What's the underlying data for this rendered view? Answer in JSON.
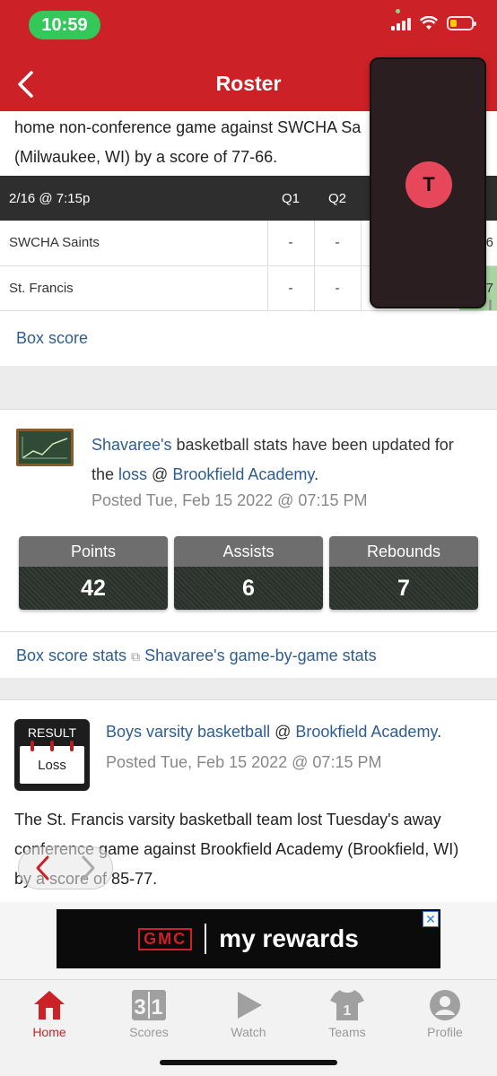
{
  "status": {
    "time": "10:59"
  },
  "nav": {
    "title": "Roster"
  },
  "story1": {
    "line1": "home non-conference game against SWCHA Sa",
    "line2": "(Milwaukee, WI) by a score of 77-66."
  },
  "scoreboard": {
    "header": [
      "2/16 @ 7:15p",
      "Q1",
      "Q2"
    ],
    "rows": [
      {
        "team": "SWCHA Saints",
        "q1": "-",
        "q2": "-",
        "final": "6"
      },
      {
        "team": "St. Francis",
        "q1": "-",
        "q2": "-",
        "final": "7"
      }
    ]
  },
  "box_score_link": "Box score",
  "stats_update": {
    "name": "Shavaree's",
    "text_mid": " basketball stats have been updated for",
    "text_the": "the ",
    "result_word": "loss",
    "at": " @ ",
    "opponent": "Brookfield Academy",
    "period": ".",
    "posted": "Posted Tue, Feb 15 2022 @ 07:15 PM",
    "stats": [
      {
        "label": "Points",
        "value": "42"
      },
      {
        "label": "Assists",
        "value": "6"
      },
      {
        "label": "Rebounds",
        "value": "7"
      }
    ],
    "link_box_stats": "Box score stats",
    "link_game_by_game": "Shavaree's game-by-game stats"
  },
  "result_post": {
    "icon_top": "RESULT",
    "icon_bottom": "Loss",
    "team_link": "Boys varsity basketball",
    "at": " @ ",
    "opponent": "Brookfield Academy",
    "period": ".",
    "posted": "Posted Tue, Feb 15 2022 @ 07:15 PM",
    "body_line1": "The St. Francis varsity basketball team lost Tuesday's away",
    "body_line2": "conference game against Brookfield Academy (Brookfield, WI)",
    "body_line3": "by a score of 85-77."
  },
  "overlay": {
    "avatar_letter": "T"
  },
  "ad": {
    "brand": "GMC",
    "text": "my rewards",
    "close": "✕"
  },
  "tabs": [
    {
      "label": "Home",
      "icon": "home-icon",
      "active": true
    },
    {
      "label": "Scores",
      "icon": "scoreboard-icon"
    },
    {
      "label": "Watch",
      "icon": "play-icon"
    },
    {
      "label": "Teams",
      "icon": "jersey-icon"
    },
    {
      "label": "Profile",
      "icon": "profile-icon"
    }
  ],
  "colors": {
    "brand_red": "#cc2127",
    "link_blue": "#2e5d8f",
    "status_green": "#34c759"
  }
}
